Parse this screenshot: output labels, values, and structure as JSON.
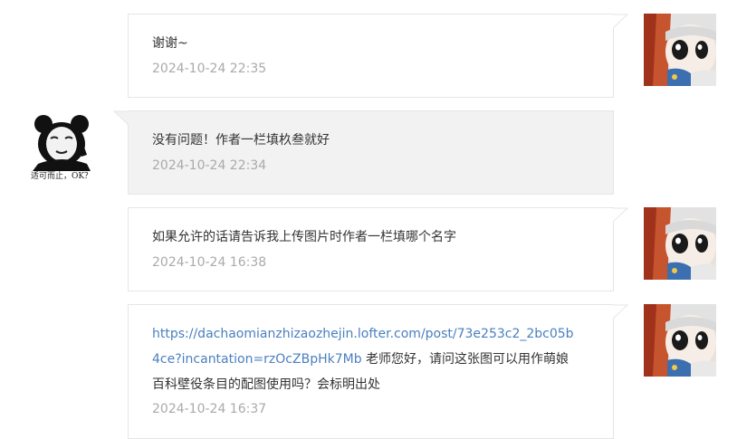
{
  "messages": [
    {
      "side": "outgoing",
      "text": "谢谢~",
      "time": "2024-10-24 22:35"
    },
    {
      "side": "incoming",
      "text": "没有问题！作者一栏填杦叁就好",
      "time": "2024-10-24 22:34"
    },
    {
      "side": "outgoing",
      "text": "如果允许的话请告诉我上传图片时作者一栏填哪个名字",
      "time": "2024-10-24 16:38"
    },
    {
      "side": "outgoing",
      "link_line_1": "https://dachaomianzhizaozhejin.lofter.com/post/73e253c2_2bc05b",
      "link_line_2": "4ce?incantation=rzOcZBpHk7Mb",
      "text_after_link": " 老师您好，请问这张图可以用作萌娘",
      "text_line_3": "百科壁役条目的配图使用吗？会标明出处",
      "time": "2024-10-24 16:37"
    }
  ],
  "other_avatar_caption": "适可而止，OK？",
  "colors": {
    "border": "#e6e6e6",
    "incoming_bg": "#f2f2f2",
    "link": "#4a7fbf",
    "timestamp": "#aaaaaa",
    "text": "#333333"
  }
}
